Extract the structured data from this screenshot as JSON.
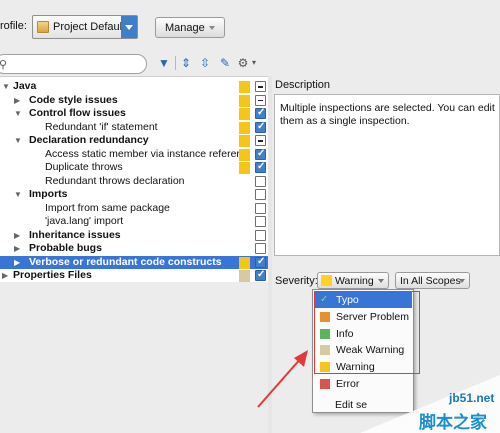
{
  "toolbar": {
    "profile_label": "rofile:",
    "profile_value": "Project Default",
    "manage_label": "Manage",
    "search_placeholder": ""
  },
  "tree": {
    "rows": [
      {
        "label": "Java",
        "level": 0,
        "bold": true,
        "expanded": true,
        "severity": "#f5c518",
        "check": "partial"
      },
      {
        "label": "Code style issues",
        "level": 1,
        "bold": true,
        "expanded": false,
        "severity": "#f5c518",
        "check": "partial"
      },
      {
        "label": "Control flow issues",
        "level": 1,
        "bold": true,
        "expanded": true,
        "severity": "#f5c518",
        "check": "checked"
      },
      {
        "label": "Redundant 'if' statement",
        "level": 2,
        "bold": false,
        "severity": "#f5c518",
        "check": "checked"
      },
      {
        "label": "Declaration redundancy",
        "level": 1,
        "bold": true,
        "expanded": true,
        "severity": "#f5c518",
        "check": "partial"
      },
      {
        "label": "Access static member via instance referer",
        "level": 2,
        "bold": false,
        "severity": "#f5c518",
        "check": "checked"
      },
      {
        "label": "Duplicate throws",
        "level": 2,
        "bold": false,
        "severity": "#f5c518",
        "check": "checked"
      },
      {
        "label": "Redundant throws declaration",
        "level": 2,
        "bold": false,
        "severity": "",
        "check": "unchecked"
      },
      {
        "label": "Imports",
        "level": 1,
        "bold": true,
        "expanded": true,
        "severity": "",
        "check": "unchecked"
      },
      {
        "label": "Import from same package",
        "level": 2,
        "bold": false,
        "severity": "",
        "check": "unchecked"
      },
      {
        "label": "'java.lang' import",
        "level": 2,
        "bold": false,
        "severity": "",
        "check": "unchecked"
      },
      {
        "label": "Inheritance issues",
        "level": 1,
        "bold": true,
        "expanded": false,
        "severity": "",
        "check": "unchecked"
      },
      {
        "label": "Probable bugs",
        "level": 1,
        "bold": true,
        "expanded": false,
        "severity": "",
        "check": "unchecked"
      },
      {
        "label": "Verbose or redundant code constructs",
        "level": 1,
        "bold": true,
        "expanded": false,
        "severity": "#f5c518",
        "check": "checked",
        "selected": true
      },
      {
        "label": "Properties Files",
        "level": 0,
        "bold": true,
        "expanded": false,
        "severity": "#d8c9a0",
        "check": "checked"
      }
    ]
  },
  "description": {
    "title": "Description",
    "text": "Multiple inspections are selected. You can edit them as a single inspection."
  },
  "severity": {
    "label": "Severity:",
    "value": "Warning",
    "value_color": "#ffd21f",
    "scope_label": "In All Scopes",
    "options": [
      {
        "label": "Typo",
        "color": "#3875d7",
        "selected": true
      },
      {
        "label": "Server Problem",
        "color": "#e8912c"
      },
      {
        "label": "Info",
        "color": "#5ab55a"
      },
      {
        "label": "Weak Warning",
        "color": "#d8c9a0"
      },
      {
        "label": "Warning",
        "color": "#f5c518"
      },
      {
        "label": "Error",
        "color": "#d9534f"
      }
    ],
    "edit_label": "Edit se"
  },
  "watermark": {
    "line1": "jb51.net",
    "line2": "脚本之家"
  }
}
